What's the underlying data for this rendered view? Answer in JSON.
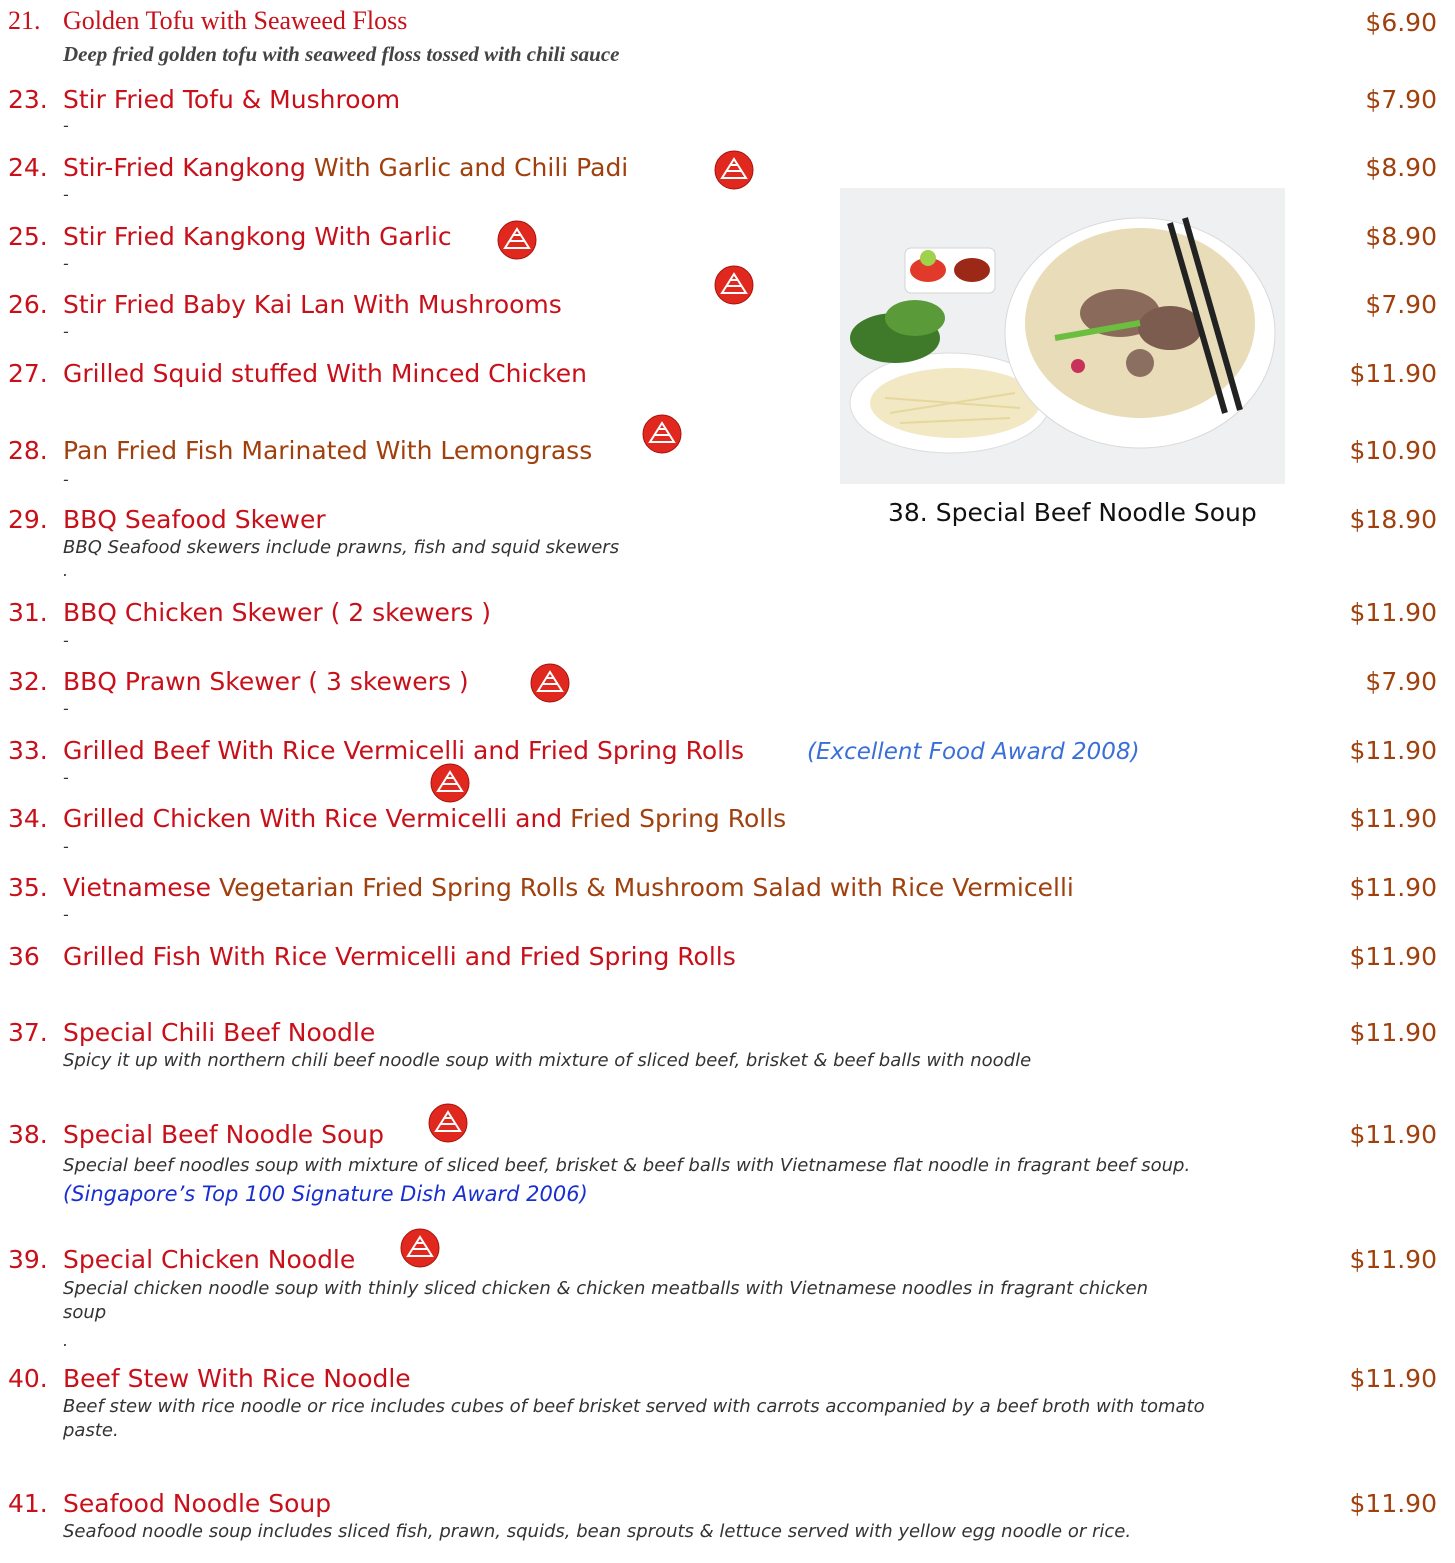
{
  "items": [
    {
      "num": "21.",
      "name": "Golden Tofu with Seaweed Floss",
      "price": "$6.90",
      "desc": "Deep fried golden tofu with seaweed floss tossed with chili sauce"
    },
    {
      "num": "23.",
      "name": "Stir Fried Tofu & Mushroom",
      "price": "$7.90",
      "dash": "-"
    },
    {
      "num": "24.",
      "name_a": "Stir-Fried Kangkong",
      "name_b": " With Garlic and Chili Padi",
      "price": "$8.90",
      "dash": "-"
    },
    {
      "num": "25.",
      "name": "Stir Fried Kangkong With Garlic",
      "price": "$8.90",
      "dash": "-"
    },
    {
      "num": "26.",
      "name": "Stir Fried Baby Kai Lan With Mushrooms",
      "price": "$7.90",
      "dash": "-"
    },
    {
      "num": "27.",
      "name": "Grilled Squid stuffed With Minced Chicken",
      "price": "$11.90"
    },
    {
      "num": "28.",
      "name": "Pan Fried Fish Marinated With Lemongrass",
      "price": "$10.90",
      "dash": "-"
    },
    {
      "num": "29.",
      "name": "BBQ Seafood Skewer",
      "price": "$18.90",
      "desc": "BBQ Seafood skewers include prawns, fish and squid skewers",
      "dash": "."
    },
    {
      "num": "31.",
      "name": "BBQ Chicken Skewer ( 2 skewers )",
      "price": "$11.90",
      "dash": "-"
    },
    {
      "num": "32.",
      "name": "BBQ Prawn Skewer ( 3 skewers )",
      "price": "$7.90",
      "dash": "-"
    },
    {
      "num": "33.",
      "name": "Grilled Beef With Rice Vermicelli and Fried Spring Rolls",
      "award": "(Excellent Food Award 2008)",
      "price": "$11.90",
      "dash": "-"
    },
    {
      "num": "34.",
      "name_a": "Grilled Chicken With Rice Vermicelli and",
      "name_b": " Fried Spring Rolls",
      "price": "$11.90",
      "dash": "-"
    },
    {
      "num": "35.",
      "name_a": "Vietnamese",
      "name_b": " Vegetarian Fried Spring Rolls & Mushroom Salad with Rice Vermicelli",
      "price": "$11.90",
      "dash": "-"
    },
    {
      "num": "36",
      "name": "Grilled Fish With Rice Vermicelli and Fried Spring Rolls",
      "price": "$11.90"
    },
    {
      "num": "37.",
      "name": "Special Chili Beef Noodle",
      "price": "$11.90",
      "desc": "Spicy it up with northern chili beef noodle soup with mixture of sliced beef, brisket & beef balls with noodle"
    },
    {
      "num": "38.",
      "name": "Special Beef Noodle Soup",
      "price": "$11.90",
      "desc": "Special beef noodles soup with mixture of sliced beef, brisket & beef balls with Vietnamese flat noodle in fragrant beef soup.",
      "award": "(Singapore’s Top 100 Signature Dish Award 2006)"
    },
    {
      "num": "39.",
      "name": "Special Chicken Noodle",
      "price": "$11.90",
      "desc": "Special chicken noodle soup with thinly sliced chicken & chicken meatballs with Vietnamese noodles in fragrant chicken soup",
      "dash": "."
    },
    {
      "num": "40.",
      "name": "Beef Stew With Rice Noodle",
      "price": "$11.90",
      "desc": "Beef stew with rice noodle or rice includes cubes of beef brisket served with carrots accompanied by a beef broth with tomato paste."
    },
    {
      "num": "41.",
      "name": "Seafood Noodle Soup",
      "price": "$11.90",
      "desc": "Seafood noodle soup includes sliced fish, prawn, squids, bean sprouts & lettuce served with yellow egg noodle or rice."
    }
  ],
  "photo": {
    "caption": "38. Special Beef Noodle Soup"
  },
  "colors": {
    "red": "#c8101a",
    "brown": "#a0400d",
    "award_light": "#3a6fd8",
    "award_dark": "#1a2fd0",
    "badge": "#e0281e"
  },
  "icons": {
    "badge": "healthier-choice-badge-icon"
  }
}
